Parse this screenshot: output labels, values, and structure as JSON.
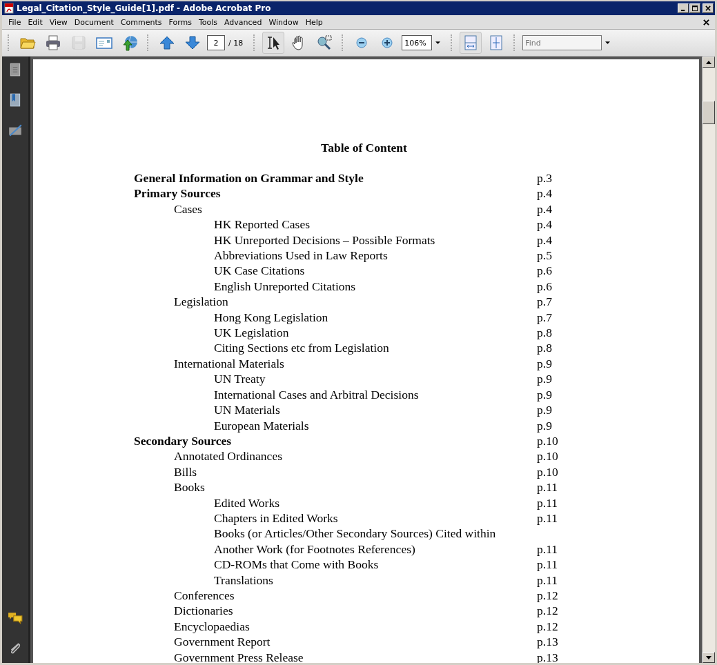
{
  "window": {
    "title": "Legal_Citation_Style_Guide[1].pdf - Adobe Acrobat Pro"
  },
  "menu": [
    {
      "label": "File"
    },
    {
      "label": "Edit"
    },
    {
      "label": "View"
    },
    {
      "label": "Document"
    },
    {
      "label": "Comments"
    },
    {
      "label": "Forms"
    },
    {
      "label": "Tools"
    },
    {
      "label": "Advanced"
    },
    {
      "label": "Window"
    },
    {
      "label": "Help"
    }
  ],
  "toolbar": {
    "tools": [
      {
        "kind": "open",
        "selected": false,
        "disabled": false
      },
      {
        "kind": "print",
        "selected": false,
        "disabled": false
      },
      {
        "kind": "save",
        "selected": false,
        "disabled": true
      },
      {
        "kind": "email",
        "selected": false,
        "disabled": false
      },
      {
        "kind": "upload",
        "selected": false,
        "disabled": false
      },
      {
        "kind": "sep"
      },
      {
        "kind": "prev",
        "selected": false,
        "disabled": false
      },
      {
        "kind": "next",
        "selected": false,
        "disabled": false
      },
      {
        "kind": "pagebox"
      },
      {
        "kind": "sep"
      },
      {
        "kind": "select",
        "selected": true,
        "disabled": false
      },
      {
        "kind": "hand",
        "selected": false,
        "disabled": false
      },
      {
        "kind": "marquee",
        "selected": false,
        "disabled": false
      },
      {
        "kind": "sep"
      },
      {
        "kind": "zoomout",
        "selected": false,
        "disabled": false
      },
      {
        "kind": "zoomin",
        "selected": false,
        "disabled": false
      },
      {
        "kind": "zoombox"
      },
      {
        "kind": "sep"
      },
      {
        "kind": "fitwidth",
        "selected": true,
        "disabled": false
      },
      {
        "kind": "fitpage",
        "selected": false,
        "disabled": false
      },
      {
        "kind": "sep"
      },
      {
        "kind": "find"
      }
    ],
    "page_number": "2",
    "page_count": "/ 18",
    "zoom": "106%",
    "find_placeholder": "Find"
  },
  "sidebar": [
    {
      "kind": "pages"
    },
    {
      "kind": "bookmarks"
    },
    {
      "kind": "signatures"
    },
    {
      "kind": "spacer"
    },
    {
      "kind": "comments"
    },
    {
      "kind": "attachments"
    }
  ],
  "document": {
    "heading": "Table of Content",
    "entries": [
      {
        "title": "General Information on Grammar and Style",
        "page": "p.3"
      },
      {
        "title": "Primary Sources",
        "page": "p.4",
        "children": [
          {
            "title": "Cases",
            "page": "p.4",
            "children": [
              {
                "title": "HK Reported Cases",
                "page": "p.4"
              },
              {
                "title": "HK Unreported Decisions – Possible Formats",
                "page": "p.4"
              },
              {
                "title": "Abbreviations Used in Law Reports",
                "page": "p.5"
              },
              {
                "title": "UK Case Citations",
                "page": "p.6"
              },
              {
                "title": "English Unreported Citations",
                "page": "p.6"
              }
            ]
          },
          {
            "title": "Legislation",
            "page": "p.7",
            "children": [
              {
                "title": "Hong Kong Legislation",
                "page": "p.7"
              },
              {
                "title": "UK Legislation",
                "page": "p.8"
              },
              {
                "title": "Citing Sections etc from Legislation",
                "page": "p.8"
              }
            ]
          },
          {
            "title": "International Materials",
            "page": "p.9",
            "children": [
              {
                "title": "UN Treaty",
                "page": "p.9"
              },
              {
                "title": "International Cases and Arbitral Decisions",
                "page": "p.9"
              },
              {
                "title": "UN Materials",
                "page": "p.9"
              },
              {
                "title": "European Materials",
                "page": "p.9"
              }
            ]
          }
        ]
      },
      {
        "title": "Secondary Sources",
        "page": "p.10",
        "children": [
          {
            "title": "Annotated Ordinances",
            "page": "p.10"
          },
          {
            "title": "Bills",
            "page": "p.10"
          },
          {
            "title": "Books",
            "page": "p.11",
            "children": [
              {
                "title": "Edited Works",
                "page": "p.11"
              },
              {
                "title": "Chapters in Edited Works",
                "page": "p.11"
              },
              {
                "title": "Books (or Articles/Other Secondary Sources) Cited within Another Work (for Footnotes References)",
                "page": "p.11"
              },
              {
                "title": "CD-ROMs that Come with Books",
                "page": "p.11"
              },
              {
                "title": "Translations",
                "page": "p.11"
              }
            ]
          },
          {
            "title": "Conferences",
            "page": "p.12"
          },
          {
            "title": "Dictionaries",
            "page": "p.12"
          },
          {
            "title": "Encyclopaedias",
            "page": "p.12"
          },
          {
            "title": "Government Report",
            "page": "p.13"
          },
          {
            "title": "Government Press Release",
            "page": "p.13"
          }
        ]
      }
    ]
  }
}
